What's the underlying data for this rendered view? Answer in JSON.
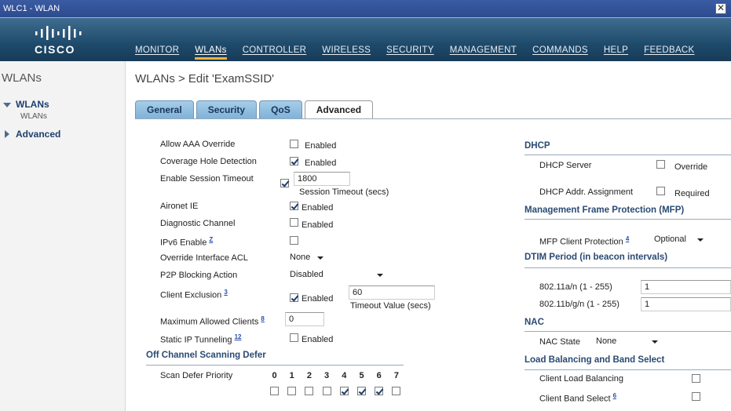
{
  "window": {
    "title": "WLC1 - WLAN",
    "close_glyph": "✕"
  },
  "brand": {
    "name": "CISCO"
  },
  "nav": [
    {
      "label": "MONITOR"
    },
    {
      "label": "WLANs"
    },
    {
      "label": "CONTROLLER"
    },
    {
      "label": "WIRELESS"
    },
    {
      "label": "SECURITY"
    },
    {
      "label": "MANAGEMENT"
    },
    {
      "label": "COMMANDS"
    },
    {
      "label": "HELP"
    },
    {
      "label": "FEEDBACK"
    }
  ],
  "nav_active": "WLANs",
  "sidebar": {
    "title": "WLANs",
    "items": [
      {
        "label": "WLANs",
        "expanded": true,
        "sub": "WLANs"
      },
      {
        "label": "Advanced",
        "expanded": false
      }
    ]
  },
  "page": {
    "title": "WLANs > Edit  'ExamSSID'"
  },
  "tabs": [
    {
      "label": "General"
    },
    {
      "label": "Security"
    },
    {
      "label": "QoS"
    },
    {
      "label": "Advanced"
    }
  ],
  "left": {
    "allow_aaa": {
      "label": "Allow AAA Override",
      "cb_label": "Enabled",
      "checked": false
    },
    "coverage_hole": {
      "label": "Coverage Hole Detection",
      "cb_label": "Enabled",
      "checked": true
    },
    "session_timeout": {
      "label": "Enable Session Timeout",
      "checked": true,
      "value": "1800",
      "unit": "Session Timeout (secs)"
    },
    "aironet_ie": {
      "label": "Aironet IE",
      "cb_label": "Enabled",
      "checked": true
    },
    "diag_channel": {
      "label": "Diagnostic Channel",
      "cb_label": "Enabled",
      "checked": false
    },
    "ipv6": {
      "label": "IPv6 Enable",
      "sup": "Z",
      "checked": false
    },
    "override_acl": {
      "label": "Override Interface ACL",
      "value": "None"
    },
    "p2p": {
      "label": "P2P Blocking Action",
      "value": "Disabled"
    },
    "client_exclusion": {
      "label": "Client Exclusion",
      "sup": "3",
      "cb_label": "Enabled",
      "checked": true,
      "value": "60",
      "unit": "Timeout Value (secs)"
    },
    "max_clients": {
      "label": "Maximum Allowed Clients",
      "sup": "8",
      "value": "0"
    },
    "static_ip": {
      "label": "Static IP Tunneling",
      "sup": "12",
      "cb_label": "Enabled",
      "checked": false
    },
    "off_channel": {
      "section": "Off Channel Scanning Defer",
      "label": "Scan Defer Priority",
      "priorities": [
        "0",
        "1",
        "2",
        "3",
        "4",
        "5",
        "6",
        "7"
      ],
      "checked": [
        false,
        false,
        false,
        false,
        true,
        true,
        true,
        false
      ]
    }
  },
  "right": {
    "dhcp": {
      "section": "DHCP",
      "server": {
        "label": "DHCP Server",
        "cb_label": "Override",
        "checked": false
      },
      "assign": {
        "label": "DHCP Addr. Assignment",
        "cb_label": "Required",
        "checked": false
      }
    },
    "mfp": {
      "section": "Management Frame Protection (MFP)",
      "label": "MFP Client Protection",
      "sup": "4",
      "value": "Optional"
    },
    "dtim": {
      "section": "DTIM Period (in beacon intervals)",
      "a": {
        "label": "802.11a/n (1 - 255)",
        "value": "1"
      },
      "b": {
        "label": "802.11b/g/n (1 - 255)",
        "value": "1"
      }
    },
    "nac": {
      "section": "NAC",
      "label": "NAC State",
      "value": "None"
    },
    "lb": {
      "section": "Load Balancing and Band Select",
      "client_lb": {
        "label": "Client Load Balancing",
        "checked": false
      },
      "band_select": {
        "label": "Client Band Select",
        "sup": "6",
        "checked": false
      }
    }
  },
  "colors": {
    "header": "#1f4a6b",
    "tab_inactive": "#8fbde0",
    "section_text": "#2a4a73",
    "nav_active_underline": "#f0b33c"
  }
}
